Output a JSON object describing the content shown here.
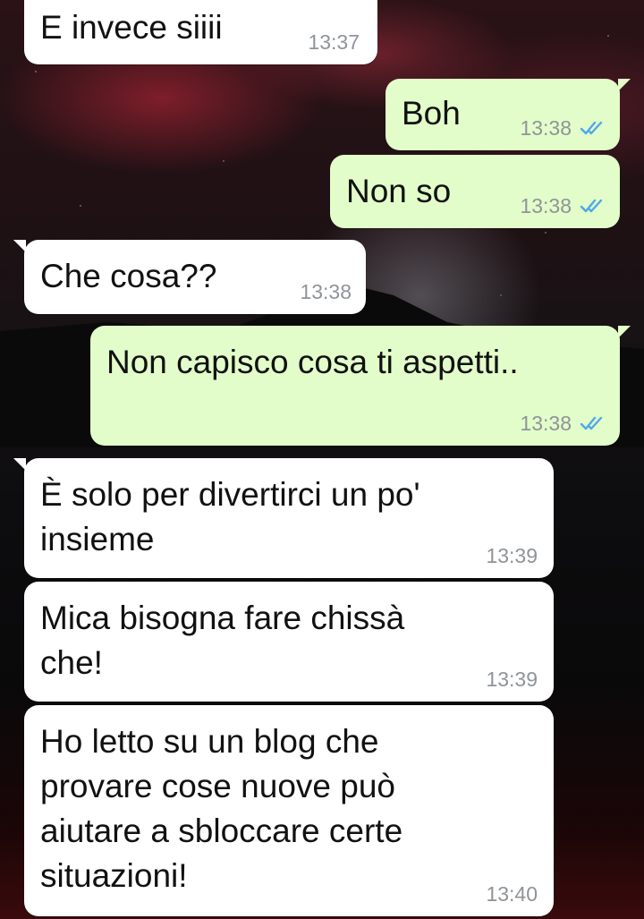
{
  "chat": {
    "messages": [
      {
        "direction": "incoming",
        "text": "E invece siiii",
        "time": "13:37"
      },
      {
        "direction": "outgoing",
        "text": "Boh",
        "time": "13:38",
        "status_icon": "double-check-read-icon"
      },
      {
        "direction": "outgoing",
        "text": "Non so",
        "time": "13:38",
        "status_icon": "double-check-read-icon"
      },
      {
        "direction": "incoming",
        "text": "Che cosa??",
        "time": "13:38"
      },
      {
        "direction": "outgoing",
        "text": "Non capisco cosa ti aspetti..",
        "time": "13:38",
        "status_icon": "double-check-read-icon"
      },
      {
        "direction": "incoming",
        "text": "È solo per divertirci un po'\ninsieme",
        "time": "13:39"
      },
      {
        "direction": "incoming",
        "text": "Mica bisogna fare chissà\nche!",
        "time": "13:39"
      },
      {
        "direction": "incoming",
        "text": "Ho letto su un blog che\nprovare cose nuove può\naiutare a sbloccare certe\nsituazioni!",
        "time": "13:40"
      }
    ]
  },
  "colors": {
    "incoming_bubble": "#ffffff",
    "outgoing_bubble": "#e2fdc9",
    "timestamp": "#8f9499",
    "read_tick": "#4fa8e8"
  }
}
